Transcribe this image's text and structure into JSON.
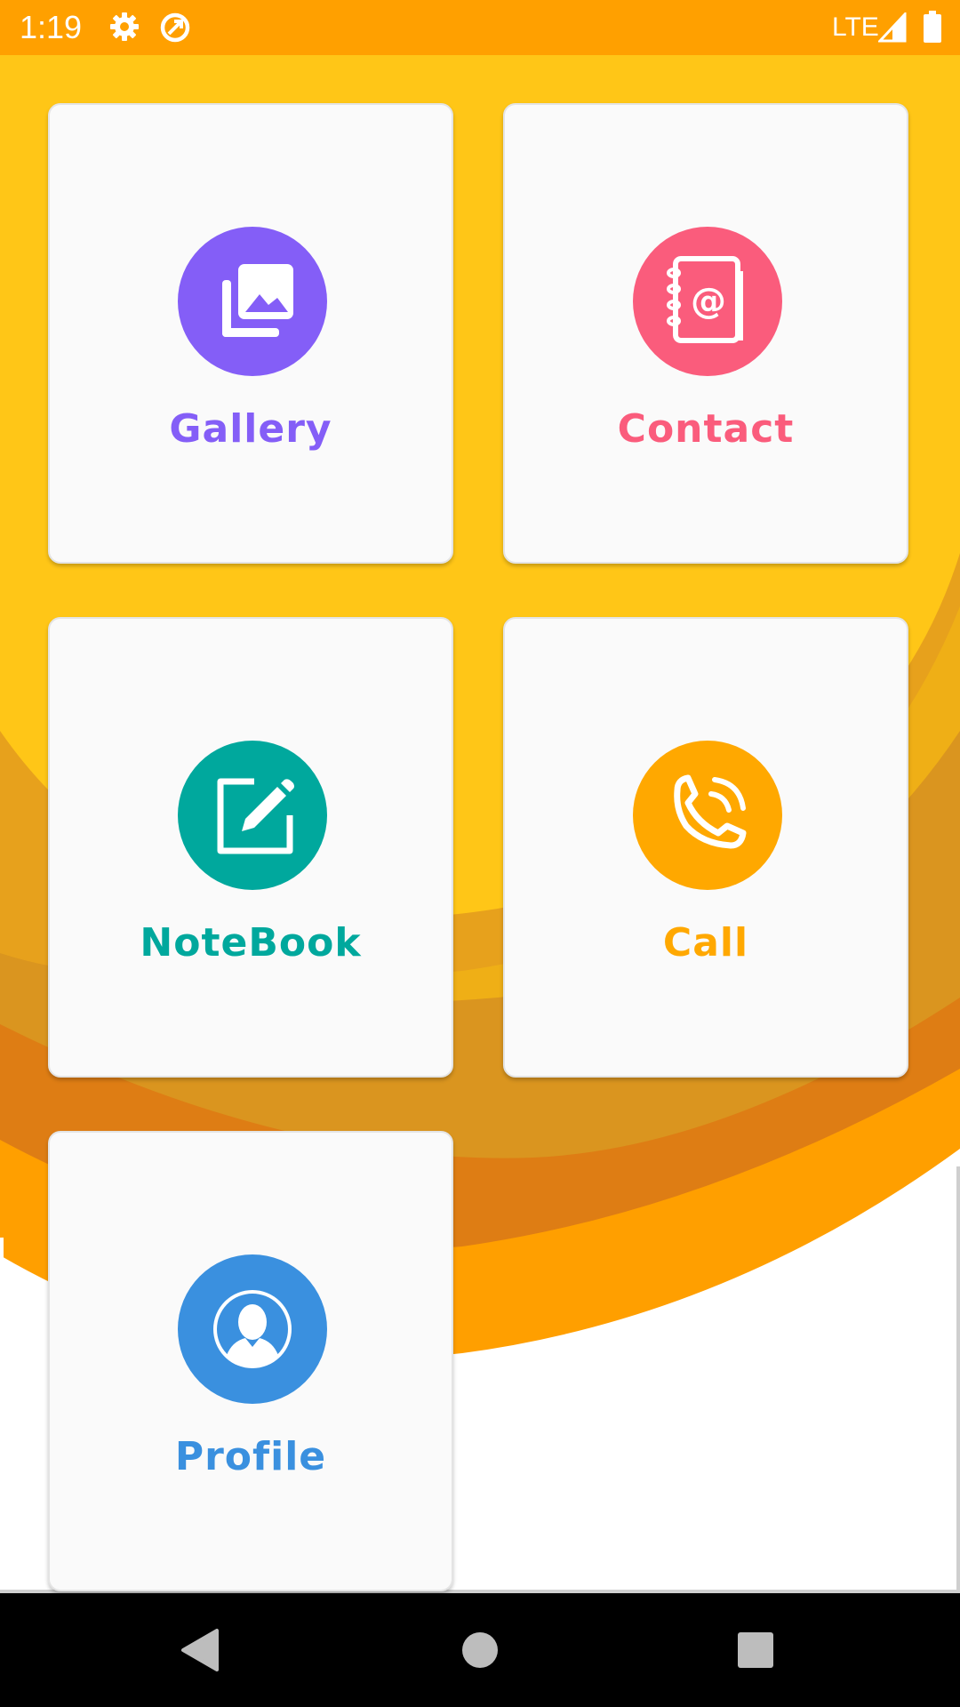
{
  "status_bar": {
    "time": "1:19",
    "network": "LTE",
    "icons": [
      "gear-icon",
      "data-saver-icon",
      "signal-icon",
      "battery-icon"
    ]
  },
  "colors": {
    "status_bar": "#FFA000",
    "background_top": "#FFC617",
    "wave_orange": "#FF9F00",
    "gallery": "#845EF7",
    "contact": "#FA5C7C",
    "notebook": "#00A89D",
    "call": "#FFA800",
    "profile": "#3A90DF"
  },
  "menu": {
    "gallery": {
      "label": "Gallery",
      "icon": "photo-library-icon"
    },
    "contact": {
      "label": "Contact",
      "icon": "address-book-icon"
    },
    "notebook": {
      "label": "NoteBook",
      "icon": "edit-note-icon"
    },
    "call": {
      "label": "Call",
      "icon": "phone-call-icon"
    },
    "profile": {
      "label": "Profile",
      "icon": "user-profile-icon"
    }
  },
  "nav_bar": {
    "icons": [
      "back-icon",
      "home-icon",
      "recents-icon"
    ]
  }
}
